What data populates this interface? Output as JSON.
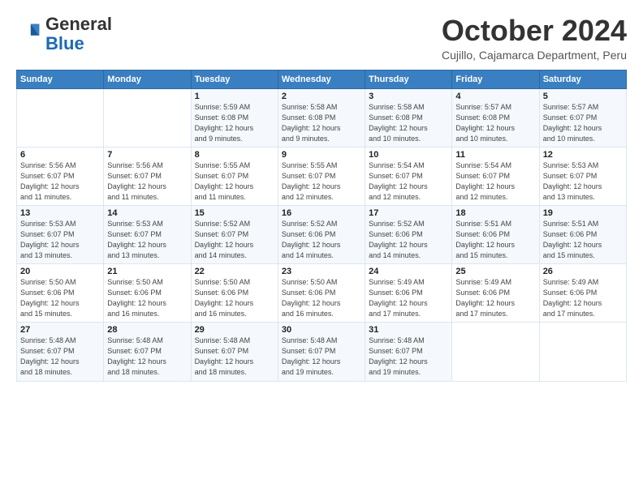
{
  "header": {
    "logo_line1": "General",
    "logo_line2": "Blue",
    "title": "October 2024",
    "subtitle": "Cujillo, Cajamarca Department, Peru"
  },
  "days_of_week": [
    "Sunday",
    "Monday",
    "Tuesday",
    "Wednesday",
    "Thursday",
    "Friday",
    "Saturday"
  ],
  "weeks": [
    [
      {
        "num": "",
        "detail": ""
      },
      {
        "num": "",
        "detail": ""
      },
      {
        "num": "1",
        "detail": "Sunrise: 5:59 AM\nSunset: 6:08 PM\nDaylight: 12 hours\nand 9 minutes."
      },
      {
        "num": "2",
        "detail": "Sunrise: 5:58 AM\nSunset: 6:08 PM\nDaylight: 12 hours\nand 9 minutes."
      },
      {
        "num": "3",
        "detail": "Sunrise: 5:58 AM\nSunset: 6:08 PM\nDaylight: 12 hours\nand 10 minutes."
      },
      {
        "num": "4",
        "detail": "Sunrise: 5:57 AM\nSunset: 6:08 PM\nDaylight: 12 hours\nand 10 minutes."
      },
      {
        "num": "5",
        "detail": "Sunrise: 5:57 AM\nSunset: 6:07 PM\nDaylight: 12 hours\nand 10 minutes."
      }
    ],
    [
      {
        "num": "6",
        "detail": "Sunrise: 5:56 AM\nSunset: 6:07 PM\nDaylight: 12 hours\nand 11 minutes."
      },
      {
        "num": "7",
        "detail": "Sunrise: 5:56 AM\nSunset: 6:07 PM\nDaylight: 12 hours\nand 11 minutes."
      },
      {
        "num": "8",
        "detail": "Sunrise: 5:55 AM\nSunset: 6:07 PM\nDaylight: 12 hours\nand 11 minutes."
      },
      {
        "num": "9",
        "detail": "Sunrise: 5:55 AM\nSunset: 6:07 PM\nDaylight: 12 hours\nand 12 minutes."
      },
      {
        "num": "10",
        "detail": "Sunrise: 5:54 AM\nSunset: 6:07 PM\nDaylight: 12 hours\nand 12 minutes."
      },
      {
        "num": "11",
        "detail": "Sunrise: 5:54 AM\nSunset: 6:07 PM\nDaylight: 12 hours\nand 12 minutes."
      },
      {
        "num": "12",
        "detail": "Sunrise: 5:53 AM\nSunset: 6:07 PM\nDaylight: 12 hours\nand 13 minutes."
      }
    ],
    [
      {
        "num": "13",
        "detail": "Sunrise: 5:53 AM\nSunset: 6:07 PM\nDaylight: 12 hours\nand 13 minutes."
      },
      {
        "num": "14",
        "detail": "Sunrise: 5:53 AM\nSunset: 6:07 PM\nDaylight: 12 hours\nand 13 minutes."
      },
      {
        "num": "15",
        "detail": "Sunrise: 5:52 AM\nSunset: 6:07 PM\nDaylight: 12 hours\nand 14 minutes."
      },
      {
        "num": "16",
        "detail": "Sunrise: 5:52 AM\nSunset: 6:06 PM\nDaylight: 12 hours\nand 14 minutes."
      },
      {
        "num": "17",
        "detail": "Sunrise: 5:52 AM\nSunset: 6:06 PM\nDaylight: 12 hours\nand 14 minutes."
      },
      {
        "num": "18",
        "detail": "Sunrise: 5:51 AM\nSunset: 6:06 PM\nDaylight: 12 hours\nand 15 minutes."
      },
      {
        "num": "19",
        "detail": "Sunrise: 5:51 AM\nSunset: 6:06 PM\nDaylight: 12 hours\nand 15 minutes."
      }
    ],
    [
      {
        "num": "20",
        "detail": "Sunrise: 5:50 AM\nSunset: 6:06 PM\nDaylight: 12 hours\nand 15 minutes."
      },
      {
        "num": "21",
        "detail": "Sunrise: 5:50 AM\nSunset: 6:06 PM\nDaylight: 12 hours\nand 16 minutes."
      },
      {
        "num": "22",
        "detail": "Sunrise: 5:50 AM\nSunset: 6:06 PM\nDaylight: 12 hours\nand 16 minutes."
      },
      {
        "num": "23",
        "detail": "Sunrise: 5:50 AM\nSunset: 6:06 PM\nDaylight: 12 hours\nand 16 minutes."
      },
      {
        "num": "24",
        "detail": "Sunrise: 5:49 AM\nSunset: 6:06 PM\nDaylight: 12 hours\nand 17 minutes."
      },
      {
        "num": "25",
        "detail": "Sunrise: 5:49 AM\nSunset: 6:06 PM\nDaylight: 12 hours\nand 17 minutes."
      },
      {
        "num": "26",
        "detail": "Sunrise: 5:49 AM\nSunset: 6:06 PM\nDaylight: 12 hours\nand 17 minutes."
      }
    ],
    [
      {
        "num": "27",
        "detail": "Sunrise: 5:48 AM\nSunset: 6:07 PM\nDaylight: 12 hours\nand 18 minutes."
      },
      {
        "num": "28",
        "detail": "Sunrise: 5:48 AM\nSunset: 6:07 PM\nDaylight: 12 hours\nand 18 minutes."
      },
      {
        "num": "29",
        "detail": "Sunrise: 5:48 AM\nSunset: 6:07 PM\nDaylight: 12 hours\nand 18 minutes."
      },
      {
        "num": "30",
        "detail": "Sunrise: 5:48 AM\nSunset: 6:07 PM\nDaylight: 12 hours\nand 19 minutes."
      },
      {
        "num": "31",
        "detail": "Sunrise: 5:48 AM\nSunset: 6:07 PM\nDaylight: 12 hours\nand 19 minutes."
      },
      {
        "num": "",
        "detail": ""
      },
      {
        "num": "",
        "detail": ""
      }
    ]
  ]
}
